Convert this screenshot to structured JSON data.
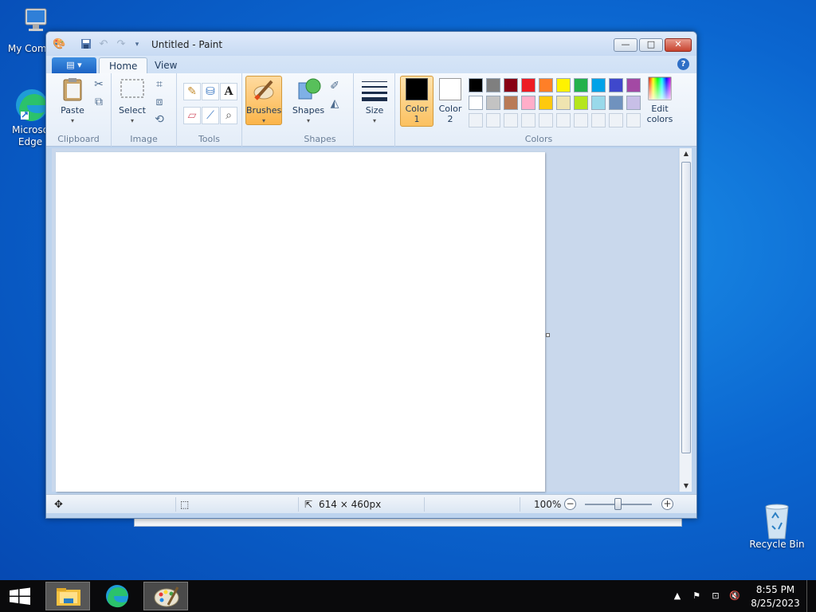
{
  "desktop": {
    "icons": [
      {
        "label": "My Comp",
        "icon": "computer-icon"
      },
      {
        "label": "Microso\nEdge",
        "icon": "edge-icon"
      },
      {
        "label": "Recycle Bin",
        "icon": "recycle-bin-icon"
      }
    ]
  },
  "window": {
    "title": "Untitled - Paint",
    "quick_access": [
      "save-icon",
      "undo-icon",
      "redo-icon",
      "customize-chevron-icon"
    ],
    "controls": {
      "minimize": "—",
      "maximize": "□",
      "close": "✕"
    }
  },
  "tabs": {
    "app_menu": "▤ ▾",
    "items": [
      {
        "label": "Home",
        "active": true
      },
      {
        "label": "View",
        "active": false
      }
    ],
    "help": "?"
  },
  "ribbon": {
    "clipboard": {
      "label": "Clipboard",
      "paste": "Paste"
    },
    "image": {
      "label": "Image",
      "select": "Select"
    },
    "tools": {
      "label": "Tools"
    },
    "brushes": {
      "label": "Brushes"
    },
    "shapes": {
      "label": "Shapes",
      "button": "Shapes"
    },
    "size": {
      "label": "Size"
    },
    "colors": {
      "label": "Colors",
      "color1": "Color\n1",
      "color2": "Color\n2",
      "edit": "Edit\ncolors",
      "color1_value": "#000000",
      "color2_value": "#ffffff",
      "palette_row1": [
        "#000000",
        "#7f7f7f",
        "#880015",
        "#ed1c24",
        "#ff7f27",
        "#fff200",
        "#22b14c",
        "#00a2e8",
        "#3f48cc",
        "#a349a4"
      ],
      "palette_row2": [
        "#ffffff",
        "#c3c3c3",
        "#b97a57",
        "#ffaec9",
        "#ffc90e",
        "#efe4b0",
        "#b5e61d",
        "#99d9ea",
        "#7092be",
        "#c8bfe7"
      ]
    }
  },
  "status": {
    "image_size": "614 × 460px",
    "zoom": "100%"
  },
  "taskbar": {
    "time": "8:55 PM",
    "date": "8/25/2023"
  }
}
